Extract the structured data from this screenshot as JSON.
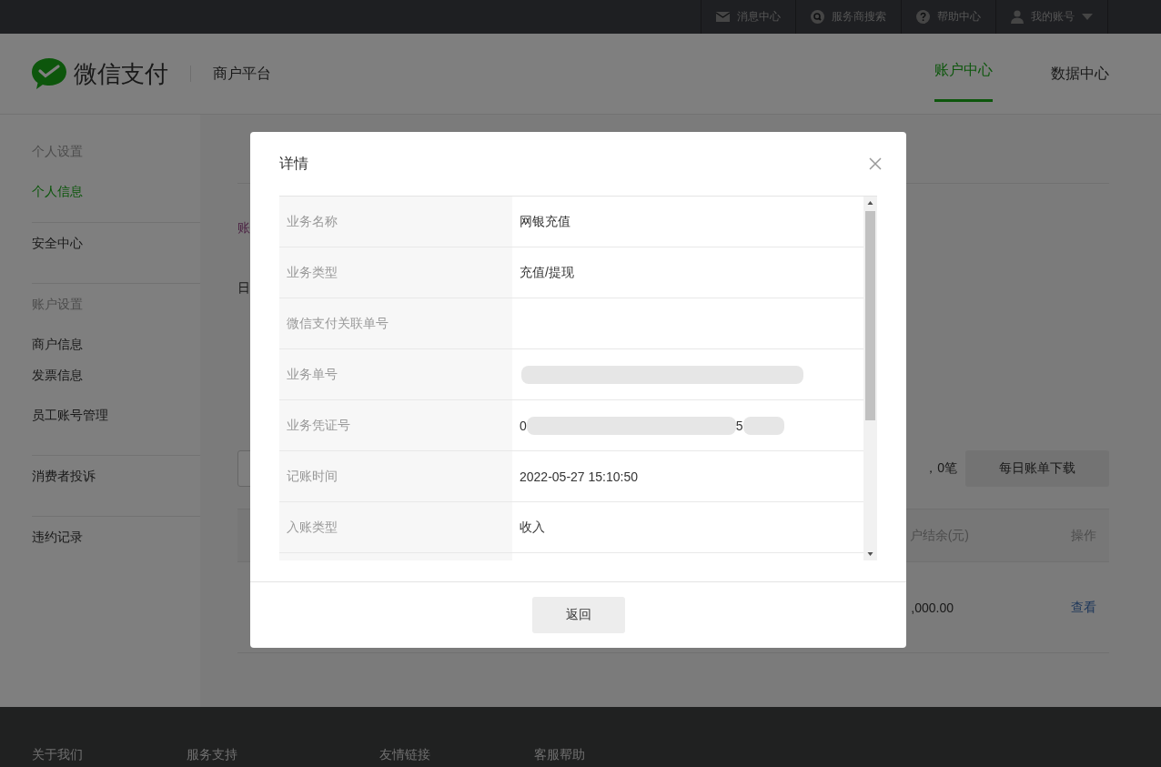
{
  "top_bar": {
    "items": [
      {
        "label": "消息中心",
        "kind": "mail"
      },
      {
        "label": "服务商搜索",
        "kind": "search"
      },
      {
        "label": "帮助中心",
        "kind": "help"
      },
      {
        "label": "我的账号",
        "kind": "account"
      }
    ]
  },
  "header": {
    "logo_text": "微信支付",
    "subtitle": "商户平台",
    "nav": [
      {
        "label": "账户中心",
        "selected": true
      },
      {
        "label": "数据中心",
        "selected": false
      }
    ]
  },
  "sidebar": {
    "sections": [
      {
        "title": "个人设置",
        "items": [
          {
            "label": "个人信息",
            "selected": true
          }
        ]
      },
      {
        "items": [
          {
            "label": "安全中心",
            "selected": false
          }
        ]
      },
      {
        "title": "账户设置",
        "items": [
          {
            "label": "商户信息",
            "selected": false
          },
          {
            "label": "发票信息",
            "selected": false
          },
          {
            "label": "员工账号管理",
            "selected": false
          }
        ]
      },
      {
        "items": [
          {
            "label": "消费者投诉",
            "selected": false
          }
        ]
      },
      {
        "items": [
          {
            "label": "违约记录",
            "selected": false
          }
        ]
      }
    ]
  },
  "content": {
    "tab": "账",
    "filter_label": "日",
    "summary": "，0笔",
    "download_button": "每日账单下载",
    "table": {
      "columns": [
        {
          "label": "户结余(元)"
        },
        {
          "label": "操作"
        }
      ],
      "rows": [
        {
          "balance": ",000.00",
          "action": "查看"
        }
      ]
    }
  },
  "dialog": {
    "title": "详情",
    "rows": [
      {
        "label": "业务名称",
        "kind": "text",
        "value": "网银充值"
      },
      {
        "label": "业务类型",
        "kind": "text",
        "value": "充值/提现"
      },
      {
        "label": "微信支付关联单号",
        "kind": "text"
      },
      {
        "label": "业务单号",
        "kind": "redacted"
      },
      {
        "label": "业务凭证号",
        "kind": "redacted",
        "visible_chars": [
          "0",
          "5"
        ]
      },
      {
        "label": "记账时间",
        "kind": "text",
        "value": "2022-05-27 15:10:50"
      },
      {
        "label": "入账类型",
        "kind": "text",
        "value": "收入"
      }
    ],
    "button": "返回"
  },
  "footer": {
    "columns": [
      "关于我们",
      "服务支持",
      "友情链接",
      "客服帮助"
    ]
  }
}
